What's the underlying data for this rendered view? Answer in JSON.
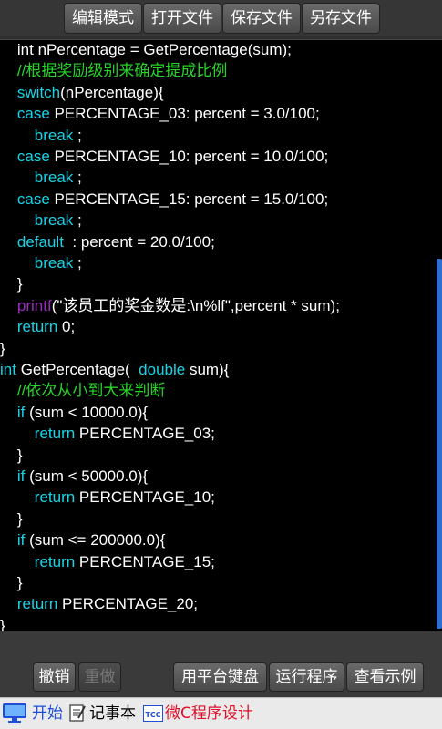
{
  "toolbar": {
    "edit_mode": "编辑模式",
    "open_file": "打开文件",
    "save_file": "保存文件",
    "save_as": "另存文件"
  },
  "code_lines": [
    [
      {
        "t": "txt",
        "s": "    int nPercentage = GetPercentage(sum);"
      }
    ],
    [
      {
        "t": "cmt",
        "s": "    //根据奖励级别来确定提成比例"
      }
    ],
    [
      {
        "t": "kw",
        "s": "    switch"
      },
      {
        "t": "txt",
        "s": "(nPercentage){"
      }
    ],
    [
      {
        "t": "kw",
        "s": "    case"
      },
      {
        "t": "txt",
        "s": " PERCENTAGE_03: percent = 3.0/100;"
      }
    ],
    [
      {
        "t": "kw",
        "s": "        break"
      },
      {
        "t": "txt",
        "s": " ;"
      }
    ],
    [
      {
        "t": "kw",
        "s": "    case"
      },
      {
        "t": "txt",
        "s": " PERCENTAGE_10: percent = 10.0/100;"
      }
    ],
    [
      {
        "t": "kw",
        "s": "        break"
      },
      {
        "t": "txt",
        "s": " ;"
      }
    ],
    [
      {
        "t": "kw",
        "s": "    case"
      },
      {
        "t": "txt",
        "s": " PERCENTAGE_15: percent = 15.0/100;"
      }
    ],
    [
      {
        "t": "kw",
        "s": "        break"
      },
      {
        "t": "txt",
        "s": " ;"
      }
    ],
    [
      {
        "t": "kw",
        "s": "    default"
      },
      {
        "t": "txt",
        "s": "  : percent = 20.0/100;"
      }
    ],
    [
      {
        "t": "kw",
        "s": "        break"
      },
      {
        "t": "txt",
        "s": " ;"
      }
    ],
    [
      {
        "t": "txt",
        "s": "    }"
      }
    ],
    [
      {
        "t": "fn",
        "s": "    printf"
      },
      {
        "t": "txt",
        "s": "(\"该员工的奖金数是:\\n%lf\",percent * sum);"
      }
    ],
    [
      {
        "t": "kw",
        "s": "    return"
      },
      {
        "t": "txt",
        "s": " 0;"
      }
    ],
    [
      {
        "t": "txt",
        "s": "}"
      }
    ],
    [
      {
        "t": "kw",
        "s": "int"
      },
      {
        "t": "txt",
        "s": " GetPercentage(  "
      },
      {
        "t": "kw",
        "s": "double"
      },
      {
        "t": "txt",
        "s": " sum){"
      }
    ],
    [
      {
        "t": "cmt",
        "s": "    //依次从小到大来判断"
      }
    ],
    [
      {
        "t": "kw",
        "s": "    if"
      },
      {
        "t": "txt",
        "s": " (sum < 10000.0){"
      }
    ],
    [
      {
        "t": "kw",
        "s": "        return"
      },
      {
        "t": "txt",
        "s": " PERCENTAGE_03;"
      }
    ],
    [
      {
        "t": "txt",
        "s": "    }"
      }
    ],
    [
      {
        "t": "kw",
        "s": "    if"
      },
      {
        "t": "txt",
        "s": " (sum < 50000.0){"
      }
    ],
    [
      {
        "t": "kw",
        "s": "        return"
      },
      {
        "t": "txt",
        "s": " PERCENTAGE_10;"
      }
    ],
    [
      {
        "t": "txt",
        "s": "    }"
      }
    ],
    [
      {
        "t": "kw",
        "s": "    if"
      },
      {
        "t": "txt",
        "s": " (sum <= 200000.0){"
      }
    ],
    [
      {
        "t": "kw",
        "s": "        return"
      },
      {
        "t": "txt",
        "s": " PERCENTAGE_15;"
      }
    ],
    [
      {
        "t": "txt",
        "s": "    }"
      }
    ],
    [
      {
        "t": "kw",
        "s": "    return"
      },
      {
        "t": "txt",
        "s": " PERCENTAGE_20;"
      }
    ],
    [
      {
        "t": "txt",
        "s": "}"
      }
    ]
  ],
  "bottom": {
    "undo": "撤销",
    "redo": "重做",
    "platform_keyboard": "用平台键盘",
    "run_program": "运行程序",
    "view_example": "查看示例"
  },
  "taskbar": {
    "start": "开始",
    "notepad": "记事本",
    "tcc_icon_text": "TCC",
    "tcc_app": "微C程序设计"
  },
  "colors": {
    "keyword": "#19d3e6",
    "comment": "#27d427",
    "function": "#9d2bc0",
    "text": "#ffffff",
    "scrollbar": "#2d6fd0"
  },
  "scrollbar": {
    "position_fraction": 0.37,
    "visible_fraction": 0.63
  }
}
